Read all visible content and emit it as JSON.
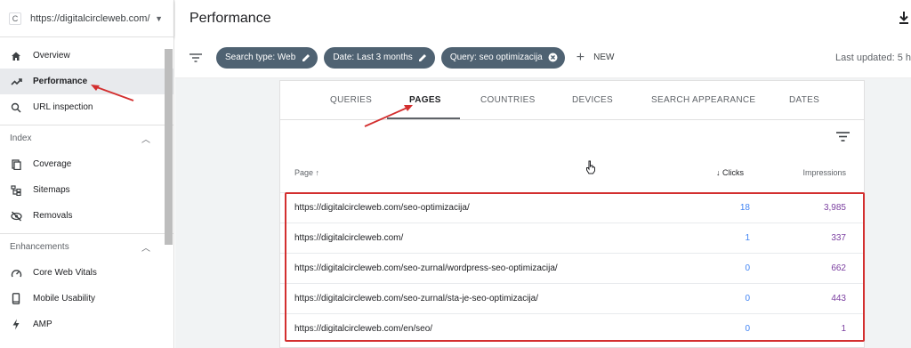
{
  "property": {
    "url": "https://digitalcircleweb.com/",
    "favicon": "C"
  },
  "sidebar": {
    "items": [
      {
        "label": "Overview",
        "icon": "home-icon"
      },
      {
        "label": "Performance",
        "icon": "trending-up-icon",
        "active": true
      },
      {
        "label": "URL inspection",
        "icon": "search-icon"
      }
    ],
    "index_section": "Index",
    "index_items": [
      {
        "label": "Coverage",
        "icon": "coverage-icon"
      },
      {
        "label": "Sitemaps",
        "icon": "sitemap-icon"
      },
      {
        "label": "Removals",
        "icon": "removals-icon"
      }
    ],
    "enh_section": "Enhancements",
    "enh_items": [
      {
        "label": "Core Web Vitals",
        "icon": "gauge-icon"
      },
      {
        "label": "Mobile Usability",
        "icon": "phone-icon"
      },
      {
        "label": "AMP",
        "icon": "bolt-icon"
      }
    ]
  },
  "header": {
    "title": "Performance"
  },
  "filters": {
    "chips": [
      "Search type: Web",
      "Date: Last 3 months",
      "Query: seo optimizacija"
    ],
    "new_label": "NEW",
    "last_updated": "Last updated: 5 h"
  },
  "tabs": [
    "QUERIES",
    "PAGES",
    "COUNTRIES",
    "DEVICES",
    "SEARCH APPEARANCE",
    "DATES"
  ],
  "table": {
    "headers": {
      "page": "Page ↑",
      "clicks": "Clicks",
      "impressions": "Impressions"
    },
    "rows": [
      {
        "page": "https://digitalcircleweb.com/seo-optimizacija/",
        "clicks": "18",
        "impressions": "3,985"
      },
      {
        "page": "https://digitalcircleweb.com/",
        "clicks": "1",
        "impressions": "337"
      },
      {
        "page": "https://digitalcircleweb.com/seo-zurnal/wordpress-seo-optimizacija/",
        "clicks": "0",
        "impressions": "662"
      },
      {
        "page": "https://digitalcircleweb.com/seo-zurnal/sta-je-seo-optimizacija/",
        "clicks": "0",
        "impressions": "443"
      },
      {
        "page": "https://digitalcircleweb.com/en/seo/",
        "clicks": "0",
        "impressions": "1"
      }
    ]
  },
  "colors": {
    "chip": "#4f6272",
    "clicks": "#4285f4",
    "impressions": "#7b3fa0",
    "annotation": "#d32f2f"
  }
}
